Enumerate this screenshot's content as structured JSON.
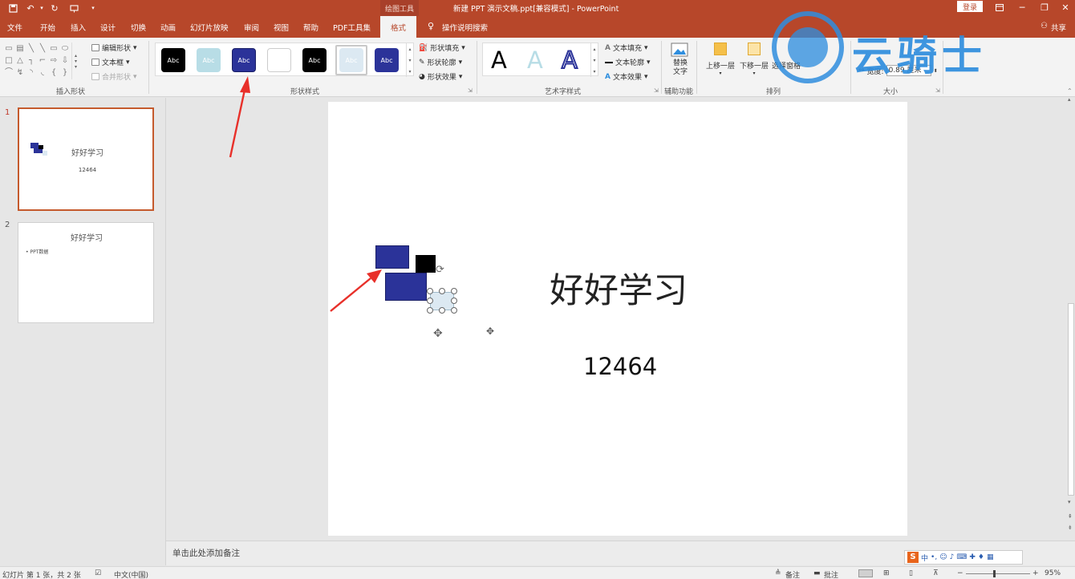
{
  "titlebar": {
    "context_tools": "绘图工具",
    "doc_title": "新建 PPT 演示文稿.ppt[兼容模式] - PowerPoint",
    "login": "登录"
  },
  "tabs": [
    {
      "label": "文件"
    },
    {
      "label": "开始"
    },
    {
      "label": "插入"
    },
    {
      "label": "设计"
    },
    {
      "label": "切换"
    },
    {
      "label": "动画"
    },
    {
      "label": "幻灯片放映"
    },
    {
      "label": "审阅"
    },
    {
      "label": "视图"
    },
    {
      "label": "帮助"
    },
    {
      "label": "PDF工具集"
    },
    {
      "label": "格式",
      "active": true
    }
  ],
  "tell_me": "操作说明搜索",
  "share": "共享",
  "ribbon": {
    "insert_shapes": {
      "edit_shape": "编辑形状",
      "text_box": "文本框",
      "merge_shapes": "合并形状",
      "label": "插入形状"
    },
    "shape_styles": {
      "sample_text": "Abc",
      "fill": "形状填充",
      "outline": "形状轮廓",
      "effects": "形状效果",
      "label": "形状样式"
    },
    "wordart": {
      "sample_letter": "A",
      "text_fill": "文本填充",
      "text_outline": "文本轮廓",
      "text_effects": "文本效果",
      "label": "艺术字样式"
    },
    "accessibility": {
      "alt_text_line1": "替换",
      "alt_text_line2": "文字",
      "label": "辅助功能"
    },
    "arrange": {
      "bring_forward": "上移一层",
      "send_backward": "下移一层",
      "selection_pane": "选择窗格",
      "label": "排列"
    },
    "size": {
      "width_label": "宽度:",
      "width_value": "0.89 厘米",
      "label": "大小"
    }
  },
  "watermark": {
    "text": "云骑士"
  },
  "thumbnails": [
    {
      "number": "1",
      "title": "好好学习",
      "subtitle": "12464"
    },
    {
      "number": "2",
      "title": "好好学习",
      "bullet": "• PPT数据"
    }
  ],
  "slide": {
    "title": "好好学习",
    "subtitle": "12464"
  },
  "notes_placeholder": "单击此处添加备注",
  "status": {
    "slide_info": "幻灯片 第 1 张，共 2 张",
    "language": "中文(中国)",
    "notes": "备注",
    "comments": "批注",
    "zoom": "95%"
  },
  "ime": {
    "mode": "中"
  },
  "colors": {
    "ppt_accent": "#b7472a",
    "shape_blue": "#2b3399",
    "shape_light": "#dce9f2",
    "watermark_blue": "#2f8ede"
  }
}
